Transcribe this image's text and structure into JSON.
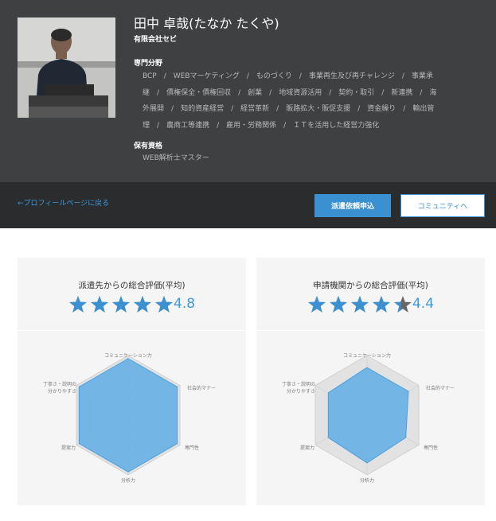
{
  "profile": {
    "name": "田中 卓哉(たなか たくや)",
    "company": "有限会社セビ",
    "expertise_label": "専門分野",
    "expertise_lines": [
      [
        "BCP",
        "WEBマーケティング",
        "ものづくり",
        "事業再生及び再チャレンジ",
        "事業承"
      ],
      [
        "継",
        "債権保全・債権回収",
        "創業",
        "地域資源活用",
        "契約・取引",
        "新連携",
        "海"
      ],
      [
        "外展開",
        "知的資産経営",
        "経営革新",
        "販路拡大・販促支援",
        "資金繰り",
        "輸出管"
      ],
      [
        "理",
        "農商工等連携",
        "雇用・労務関係",
        "ＩＴを活用した経営力強化"
      ]
    ],
    "qualification_label": "保有資格",
    "qualification": "WEB解析士マスター"
  },
  "actions": {
    "back_label": "←プロフィールページに戻る",
    "dispatch_label": "派遣依頼申込",
    "community_label": "コミュニティへ"
  },
  "colors": {
    "accent": "#3a90d0",
    "star": "#3a90d0",
    "star_empty": "#666666",
    "header_bg": "#3f4042",
    "bar_bg": "#2b2c2e"
  },
  "radar_labels": {
    "top": "コミュニケーション力",
    "upper_right": "社会的マナー",
    "lower_right": "専門性",
    "bottom": "分析力",
    "lower_left": "提案力",
    "upper_left_1": "丁寧さ・説明の",
    "upper_left_2": "分かりやすさ"
  },
  "ratings": [
    {
      "title": "派遣先からの総合評価(平均)",
      "score": "4.8",
      "stars_filled": 5,
      "axes": {
        "communication": 0.95,
        "manner": 0.95,
        "expertise": 0.95,
        "analysis": 0.95,
        "proposal": 0.95,
        "clarity": 0.95
      }
    },
    {
      "title": "申請機関からの総合評価(平均)",
      "score": "4.4",
      "stars_filled": 4.4,
      "axes": {
        "communication": 0.8,
        "manner": 0.8,
        "expertise": 0.75,
        "analysis": 0.8,
        "proposal": 0.75,
        "clarity": 0.75
      }
    }
  ]
}
